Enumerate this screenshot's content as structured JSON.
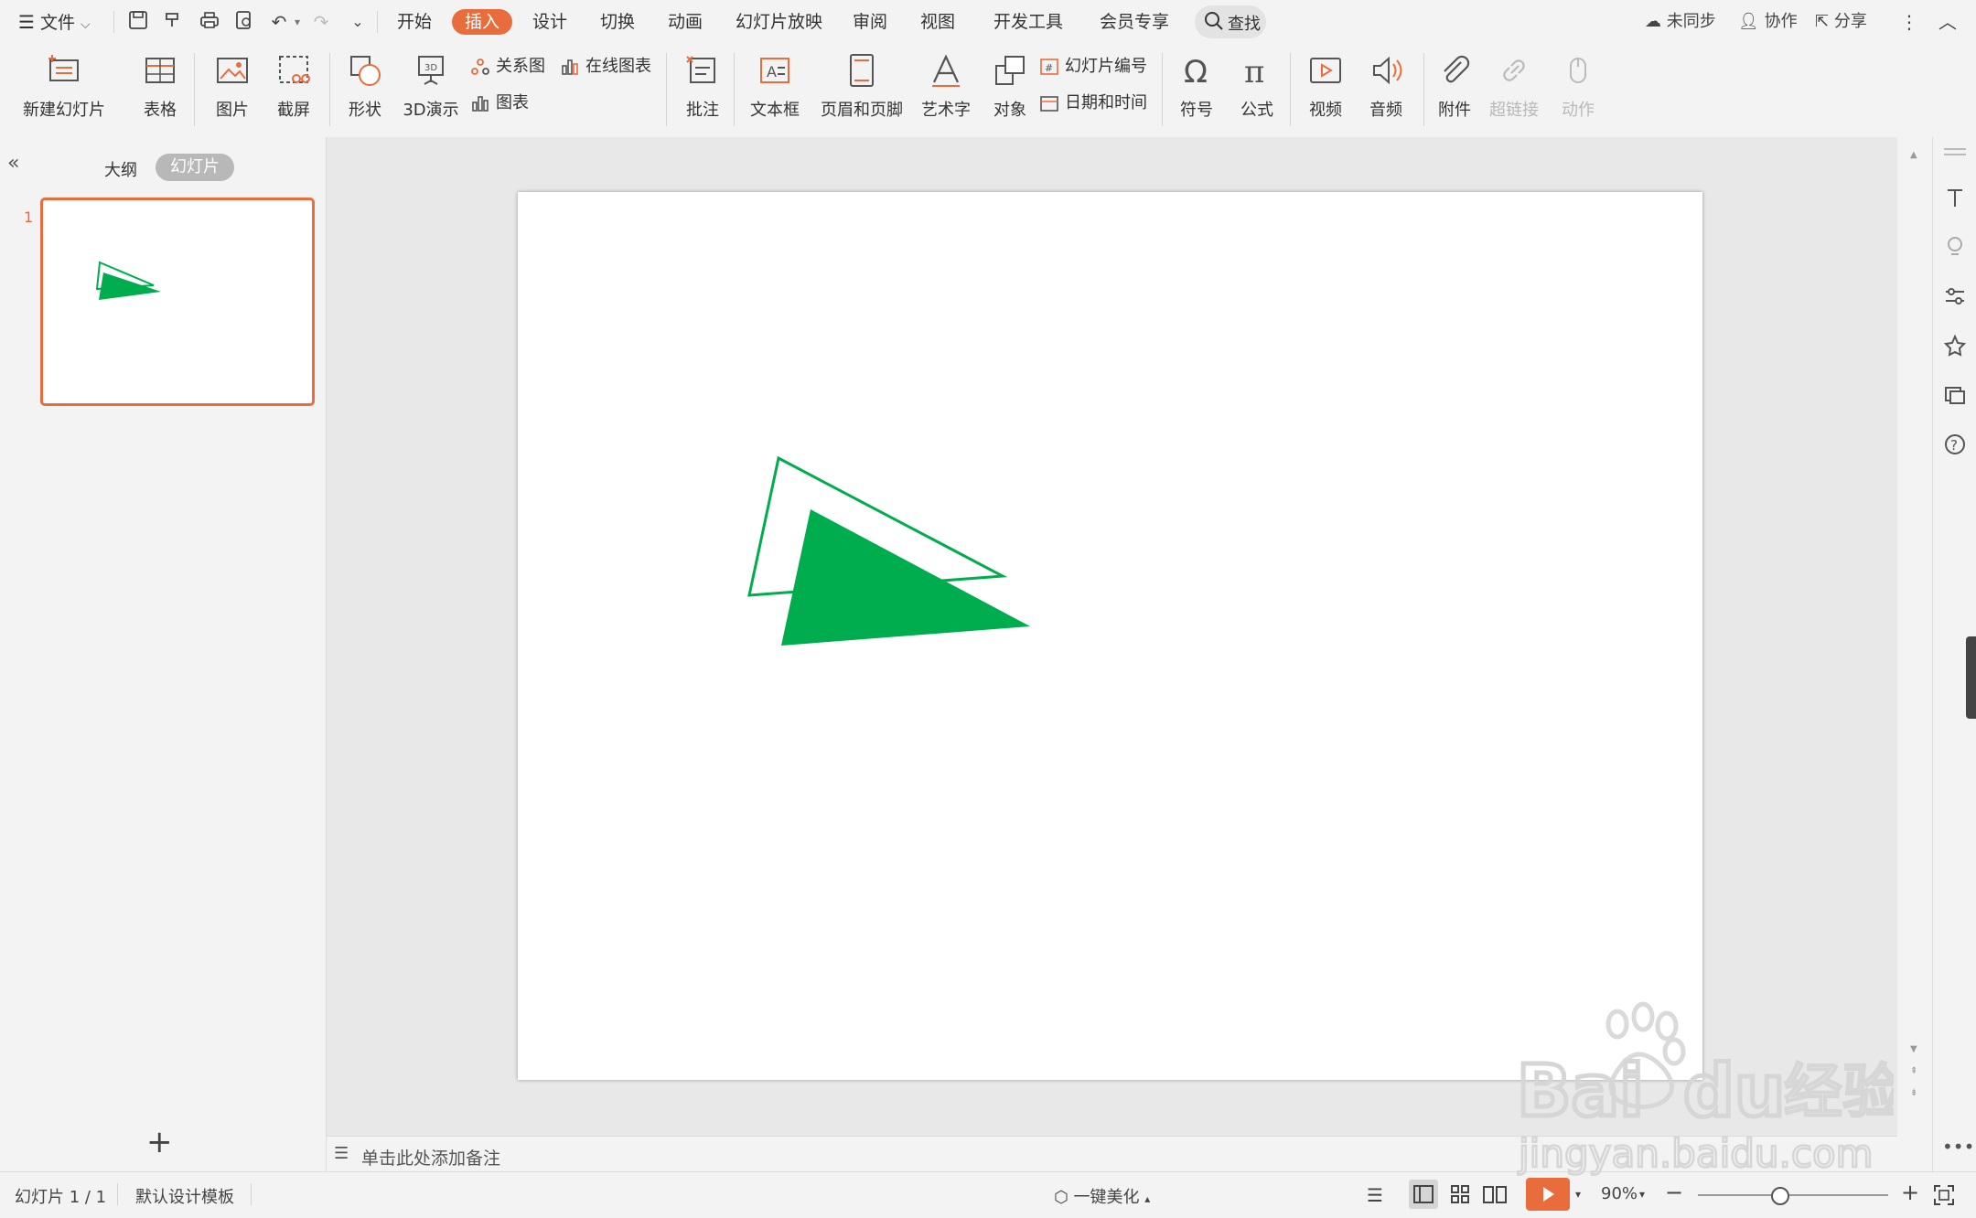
{
  "menubar": {
    "file_label": "文件",
    "tabs": [
      "开始",
      "插入",
      "设计",
      "切换",
      "动画",
      "幻灯片放映",
      "审阅",
      "视图",
      "开发工具",
      "会员专享"
    ],
    "active_tab": "插入",
    "search_label": "查找",
    "sync_label": "未同步",
    "collab_label": "协作",
    "share_label": "分享"
  },
  "ribbon": {
    "new_slide": "新建幻灯片",
    "table": "表格",
    "picture": "图片",
    "screenshot": "截屏",
    "shape": "形状",
    "demo3d": "3D演示",
    "relation": "关系图",
    "online_chart": "在线图表",
    "chart": "图表",
    "comment": "批注",
    "textbox": "文本框",
    "header_footer": "页眉和页脚",
    "wordart": "艺术字",
    "object": "对象",
    "slide_number": "幻灯片编号",
    "datetime": "日期和时间",
    "symbol": "符号",
    "formula": "公式",
    "video": "视频",
    "audio": "音频",
    "attachment": "附件",
    "hyperlink": "超链接",
    "action": "动作"
  },
  "left_panel": {
    "tab_outline": "大纲",
    "tab_slides": "幻灯片",
    "slide_index": "1"
  },
  "notes_placeholder": "单击此处添加备注",
  "status": {
    "slide_info": "幻灯片 1 / 1",
    "template": "默认设计模板",
    "beautify": "一键美化",
    "zoom": "90%"
  },
  "colors": {
    "accent": "#e96c3c",
    "shape_green": "#00ad4e"
  }
}
